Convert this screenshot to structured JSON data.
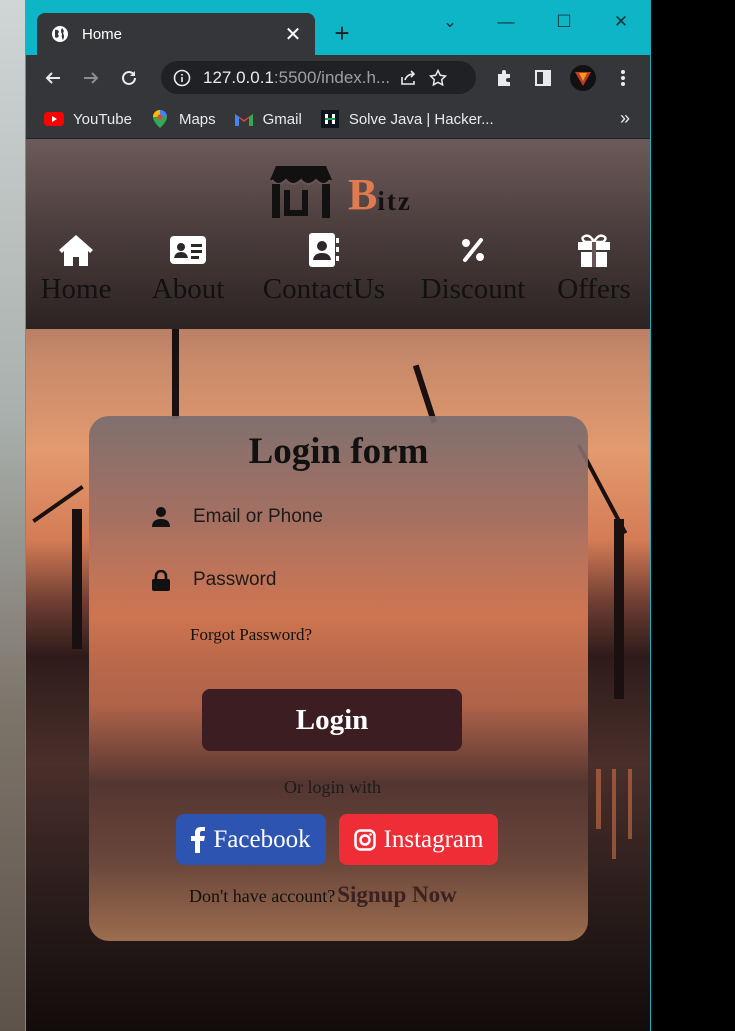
{
  "browser": {
    "tab_title": "Home",
    "url_host": "127.0.0.1",
    "url_rest": ":5500/index.h...",
    "bookmarks": [
      {
        "label": "YouTube",
        "icon": "youtube-icon"
      },
      {
        "label": "Maps",
        "icon": "maps-icon"
      },
      {
        "label": "Gmail",
        "icon": "gmail-icon"
      },
      {
        "label": "Solve Java | Hacker...",
        "icon": "hackerrank-icon"
      }
    ],
    "more": "»"
  },
  "site": {
    "logo_initial": "B",
    "logo_rest": "itz",
    "nav": [
      {
        "label": "Home",
        "icon": "home-icon"
      },
      {
        "label": "About",
        "icon": "id-card-icon"
      },
      {
        "label": "ContactUs",
        "icon": "contact-book-icon"
      },
      {
        "label": "Discount",
        "icon": "percent-icon"
      },
      {
        "label": "Offers",
        "icon": "gift-icon"
      }
    ]
  },
  "login": {
    "title": "Login form",
    "email_placeholder": "Email or Phone",
    "password_placeholder": "Password",
    "forgot": "Forgot Password?",
    "button": "Login",
    "or_text": "Or login with",
    "facebook": "Facebook",
    "instagram": "Instagram",
    "no_account": "Don't have account?",
    "signup": "Signup Now"
  },
  "colors": {
    "tab_strip": "#0db5c6",
    "accent_logo": "#e07a4f",
    "login_button": "#3b1d22",
    "facebook": "#2d54b0",
    "instagram": "#ef2d37"
  }
}
